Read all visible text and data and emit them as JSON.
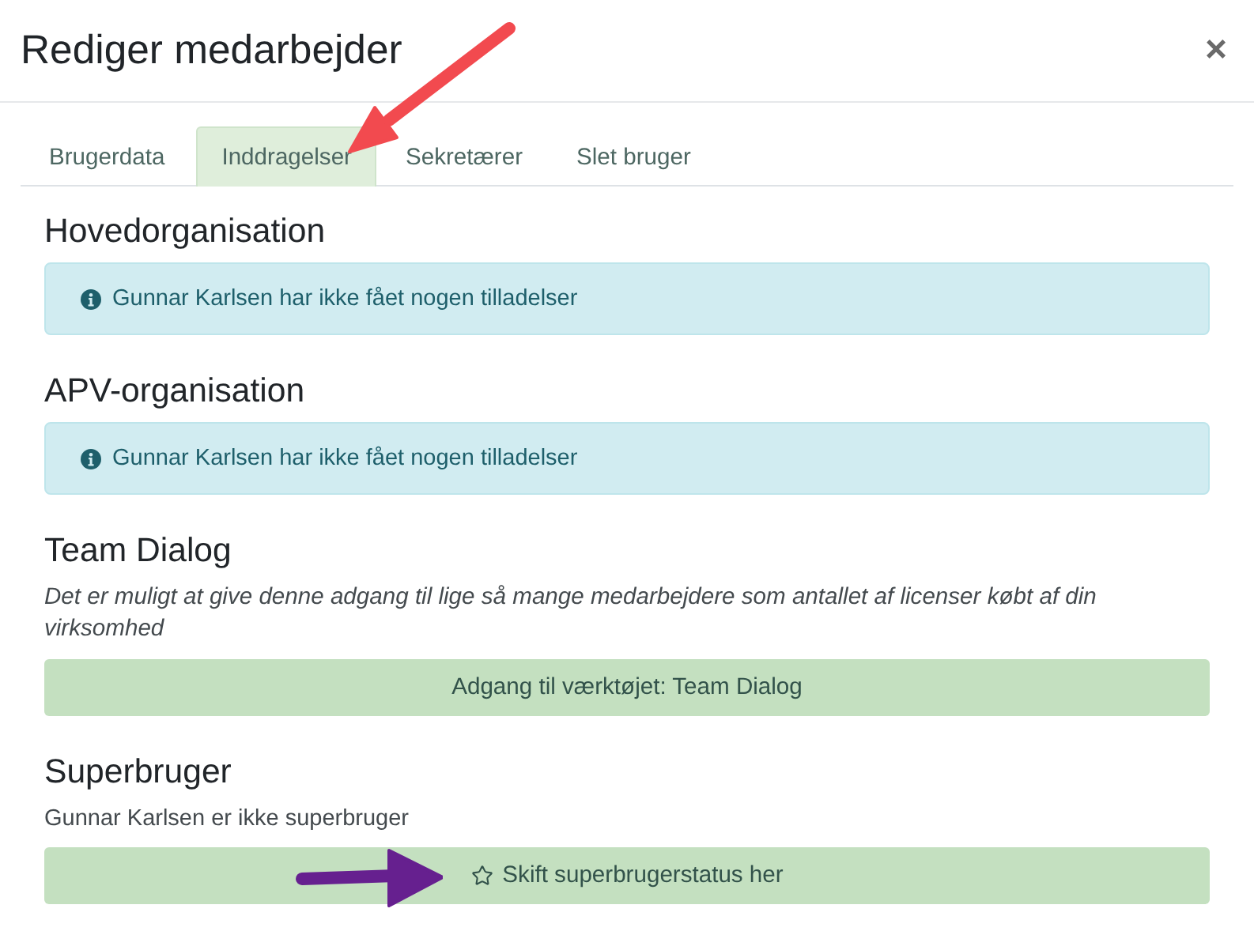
{
  "dialog": {
    "title": "Rediger medarbejder",
    "close": "×"
  },
  "tabs": [
    {
      "label": "Brugerdata",
      "selected": false
    },
    {
      "label": "Inddragelser",
      "selected": true
    },
    {
      "label": "Sekretærer",
      "selected": false
    },
    {
      "label": "Slet bruger",
      "selected": false
    }
  ],
  "sections": [
    {
      "kind": "alert",
      "heading": "Hovedorganisation",
      "message": "Gunnar Karlsen har ikke fået nogen tilladelser"
    },
    {
      "kind": "alert",
      "heading": "APV-organisation",
      "message": "Gunnar Karlsen har ikke fået nogen tilladelser"
    },
    {
      "kind": "action",
      "heading": "Team Dialog",
      "description": "Det er muligt at give denne adgang til lige så mange medarbejdere som antallet af licenser købt af din virksomhed",
      "button": {
        "label": "Adgang til værktøjet: Team Dialog"
      }
    },
    {
      "kind": "action",
      "heading": "Superbruger",
      "note": "Gunnar Karlsen er ikke superbruger",
      "button": {
        "label": "Skift superbrugerstatus her",
        "icon": true
      }
    }
  ],
  "annotations": [
    {
      "kind": "arrow",
      "color": "#f24a4f"
    },
    {
      "kind": "arrow",
      "color": "#66208f"
    }
  ]
}
